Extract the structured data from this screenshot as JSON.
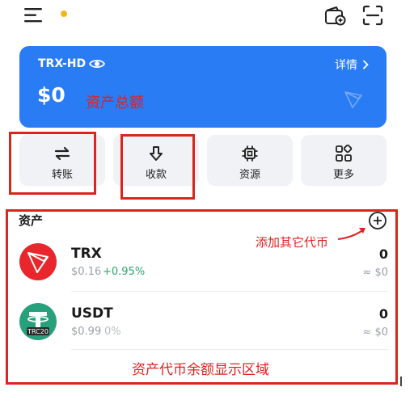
{
  "header": {
    "menu_icon": "hamburger-icon",
    "wallet_icon": "wallet-add-icon",
    "scan_icon": "scan-icon",
    "notification_color": "#f3b51b"
  },
  "card": {
    "wallet_name": "TRX-HD",
    "detail_label": "详情",
    "balance": "$0",
    "annotation": "资产总额",
    "bg_color": "#2a7cf4"
  },
  "actions": [
    {
      "label": "转账",
      "icon": "transfer-icon"
    },
    {
      "label": "收款",
      "icon": "receive-icon"
    },
    {
      "label": "资源",
      "icon": "resource-icon"
    },
    {
      "label": "更多",
      "icon": "more-icon"
    }
  ],
  "assets": {
    "title": "资产",
    "add_annotation": "添加其它代币",
    "area_annotation": "资产代币余额显示区域",
    "tokens": [
      {
        "symbol": "TRX",
        "price": "$0.16",
        "change": "+0.95%",
        "amount": "0",
        "value": "≈ $0"
      },
      {
        "symbol": "USDT",
        "price": "$0.99",
        "change": "0%",
        "amount": "0",
        "value": "≈ $0",
        "network_badge": "TRC20"
      }
    ]
  },
  "colors": {
    "accent": "#2a7cf4",
    "positive": "#2aa86b",
    "annotation": "#e02020"
  }
}
